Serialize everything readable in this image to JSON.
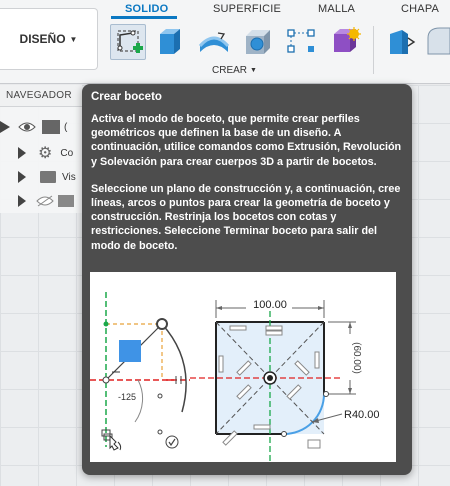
{
  "toolbar": {
    "workspace_button": "DISEÑO",
    "tabs": [
      "SOLIDO",
      "SUPERFICIE",
      "MALLA",
      "CHAPA"
    ],
    "active_tab": "SOLIDO",
    "group_label": "CREAR",
    "accent_color": "#0b78c2"
  },
  "browser": {
    "header": "NAVEGADOR",
    "rows": [
      {
        "label": "(",
        "icon": "eye-icon"
      },
      {
        "label": "Co",
        "icon": "gear-icon"
      },
      {
        "label": "Vis",
        "icon": "folder-icon"
      },
      {
        "label": "",
        "icon": "hidden-eye-icon"
      }
    ]
  },
  "tooltip": {
    "title": "Crear boceto",
    "paragraph1": "Activa el modo de boceto, que permite crear perfiles geométricos que definen la base de un diseño. A continuación, utilice comandos como Extrusión, Revolución y Solevación para crear cuerpos 3D a partir de bocetos.",
    "paragraph2": "Seleccione un plano de construcción y, a continuación, cree líneas, arcos o puntos para crear la geometría de boceto y construcción. Restrinja los bocetos con cotas y restricciones. Seleccione Terminar boceto para salir del modo de boceto.",
    "illustration": {
      "dimension_width": "100.00",
      "dimension_height": "(60.00)",
      "radius": "R40.00",
      "angle_value": "-125"
    }
  }
}
